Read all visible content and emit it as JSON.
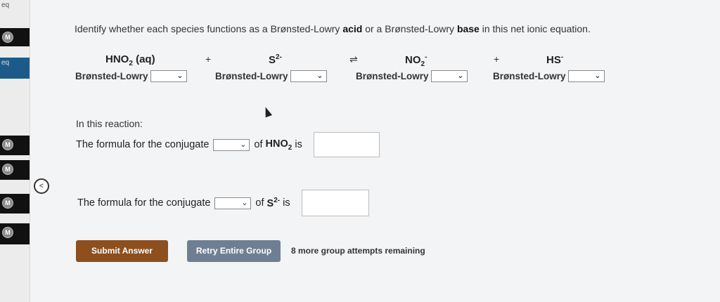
{
  "sidebar": {
    "top_label": "eq",
    "tabs": [
      {
        "label": "eq",
        "badge": ""
      },
      {
        "label": "",
        "badge": "M"
      },
      {
        "label": "",
        "badge": "M"
      },
      {
        "label": "",
        "badge": "M"
      },
      {
        "label": "",
        "badge": "M"
      }
    ],
    "first_badge": "M",
    "collapse_glyph": "<"
  },
  "question": {
    "instructions_pre": "Identify whether each species functions as a Brønsted-Lowry ",
    "acid_word": "acid",
    "instructions_mid": " or a Brønsted-Lowry ",
    "base_word": "base",
    "instructions_post": " in this net ionic equation."
  },
  "equation": {
    "species1_main": "HNO",
    "species1_sub": "2",
    "species1_state": " (aq)",
    "plus1": "+",
    "species2_main": "S",
    "species2_sup": "2-",
    "arrow": "⇌",
    "species3_main": "NO",
    "species3_sub": "2",
    "species3_sup": "-",
    "plus2": "+",
    "species4_main": "HS",
    "species4_sup": "-"
  },
  "roles": {
    "prefix": "Brønsted-Lowry",
    "dropdown_values": [
      "",
      "",
      "",
      ""
    ]
  },
  "conjugates": {
    "heading": "In this reaction:",
    "row1_pre": "The formula for the conjugate",
    "row1_of": "of",
    "row1_species": "HNO",
    "row1_sub": "2",
    "row1_is": "is",
    "row2_pre": "The formula for the conjugate",
    "row2_of": "of",
    "row2_species": "S",
    "row2_sup": "2-",
    "row2_is": "is"
  },
  "footer": {
    "submit_label": "Submit Answer",
    "retry_label": "Retry Entire Group",
    "attempts_text": "8 more group attempts remaining"
  },
  "icons": {
    "dropdown": "chevron-down-icon",
    "collapse": "chevron-left-icon"
  },
  "colors": {
    "submit": "#8d4f1e",
    "retry": "#6f7f93",
    "sidebar_tab": "#111111"
  }
}
